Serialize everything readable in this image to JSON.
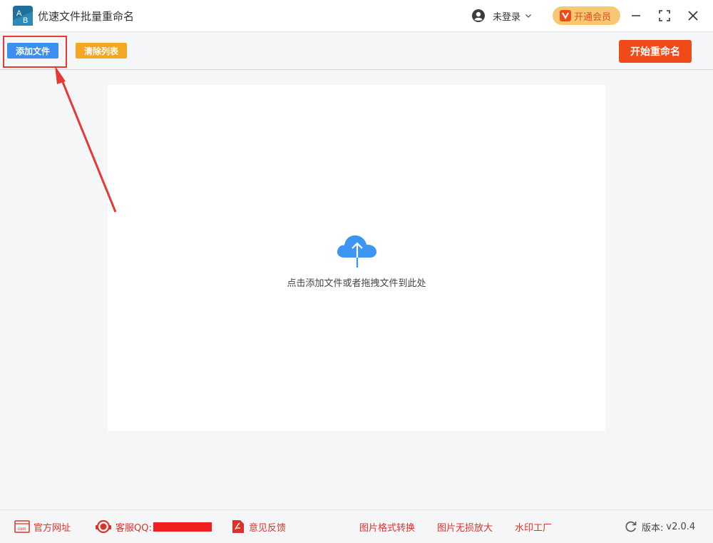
{
  "app": {
    "title": "优速文件批量重命名",
    "logo_letters": [
      "A",
      "B"
    ]
  },
  "titlebar": {
    "user_label": "未登录",
    "vip_label": "开通会员",
    "icons": {
      "user": "user-circle-icon",
      "chevron": "chevron-down-icon",
      "vip": "vip-crown-icon",
      "minimize": "minimize-icon",
      "maximize": "maximize-icon",
      "close": "close-icon"
    }
  },
  "toolbar": {
    "add_label": "添加文件",
    "clear_label": "清除列表",
    "start_label": "开始重命名"
  },
  "drop_zone": {
    "hint": "点击添加文件或者拖拽文件到此处",
    "icon": "cloud-upload-icon"
  },
  "footer": {
    "website": "官方网址",
    "support": "客服QQ:",
    "feedback": "意见反馈",
    "image_convert": "图片格式转换",
    "image_enlarge": "图片无损放大",
    "watermark": "水印工厂",
    "version_label": "版本:",
    "version_value": "v2.0.4"
  },
  "colors": {
    "accent_blue": "#3b8ff0",
    "orange": "#f5a623",
    "red": "#f0491a",
    "annotation": "#e53935",
    "vip_bg": "#f7c873"
  }
}
